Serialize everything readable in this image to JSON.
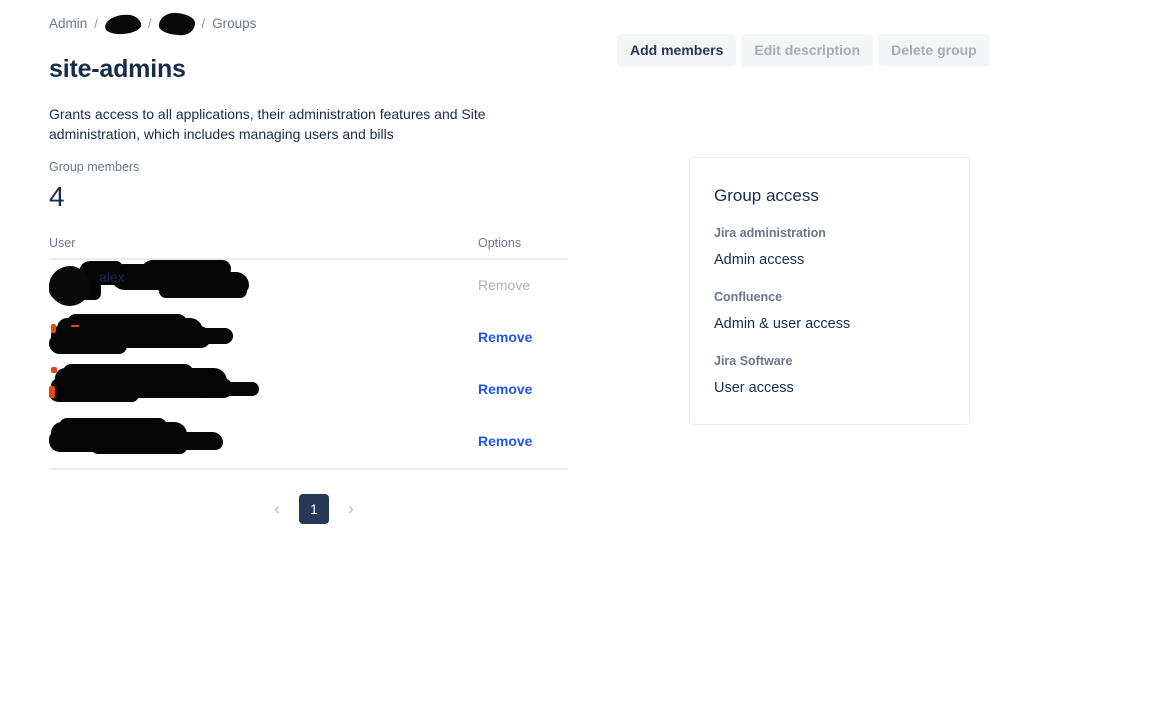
{
  "breadcrumb": {
    "items": [
      {
        "label": "Admin",
        "redacted": false
      },
      {
        "label": "",
        "redacted": true
      },
      {
        "label": "",
        "redacted": true
      },
      {
        "label": "Groups",
        "redacted": false
      }
    ],
    "separator": "/"
  },
  "page": {
    "title": "site-admins",
    "description": "Grants access to all applications, their administration features and Site administration, which includes managing users and bills"
  },
  "toolbar": {
    "add_members_label": "Add members",
    "edit_description_label": "Edit description",
    "delete_group_label": "Delete group"
  },
  "members": {
    "label": "Group members",
    "count": "4",
    "columns": {
      "user": "User",
      "options": "Options"
    },
    "rows": [
      {
        "user_visible_text": "alex",
        "redacted": true,
        "remove_label": "Remove",
        "remove_enabled": false
      },
      {
        "user_visible_text": "",
        "redacted": true,
        "remove_label": "Remove",
        "remove_enabled": true
      },
      {
        "user_visible_text": "",
        "redacted": true,
        "remove_label": "Remove",
        "remove_enabled": true
      },
      {
        "user_visible_text": "",
        "redacted": true,
        "remove_label": "Remove",
        "remove_enabled": true
      }
    ]
  },
  "pagination": {
    "prev_label": "‹",
    "next_label": "›",
    "current_page": "1"
  },
  "group_access": {
    "title": "Group access",
    "entries": [
      {
        "app": "Jira administration",
        "level": "Admin access"
      },
      {
        "app": "Confluence",
        "level": "Admin & user access"
      },
      {
        "app": "Jira Software",
        "level": "User access"
      }
    ]
  },
  "colors": {
    "text_primary": "#172b4d",
    "text_subtle": "#6b778c",
    "link_blue": "#2254e8",
    "disabled": "#a5adba",
    "button_bg": "#f4f5f7",
    "pagination_active": "#253858",
    "border": "#ebecf0"
  }
}
